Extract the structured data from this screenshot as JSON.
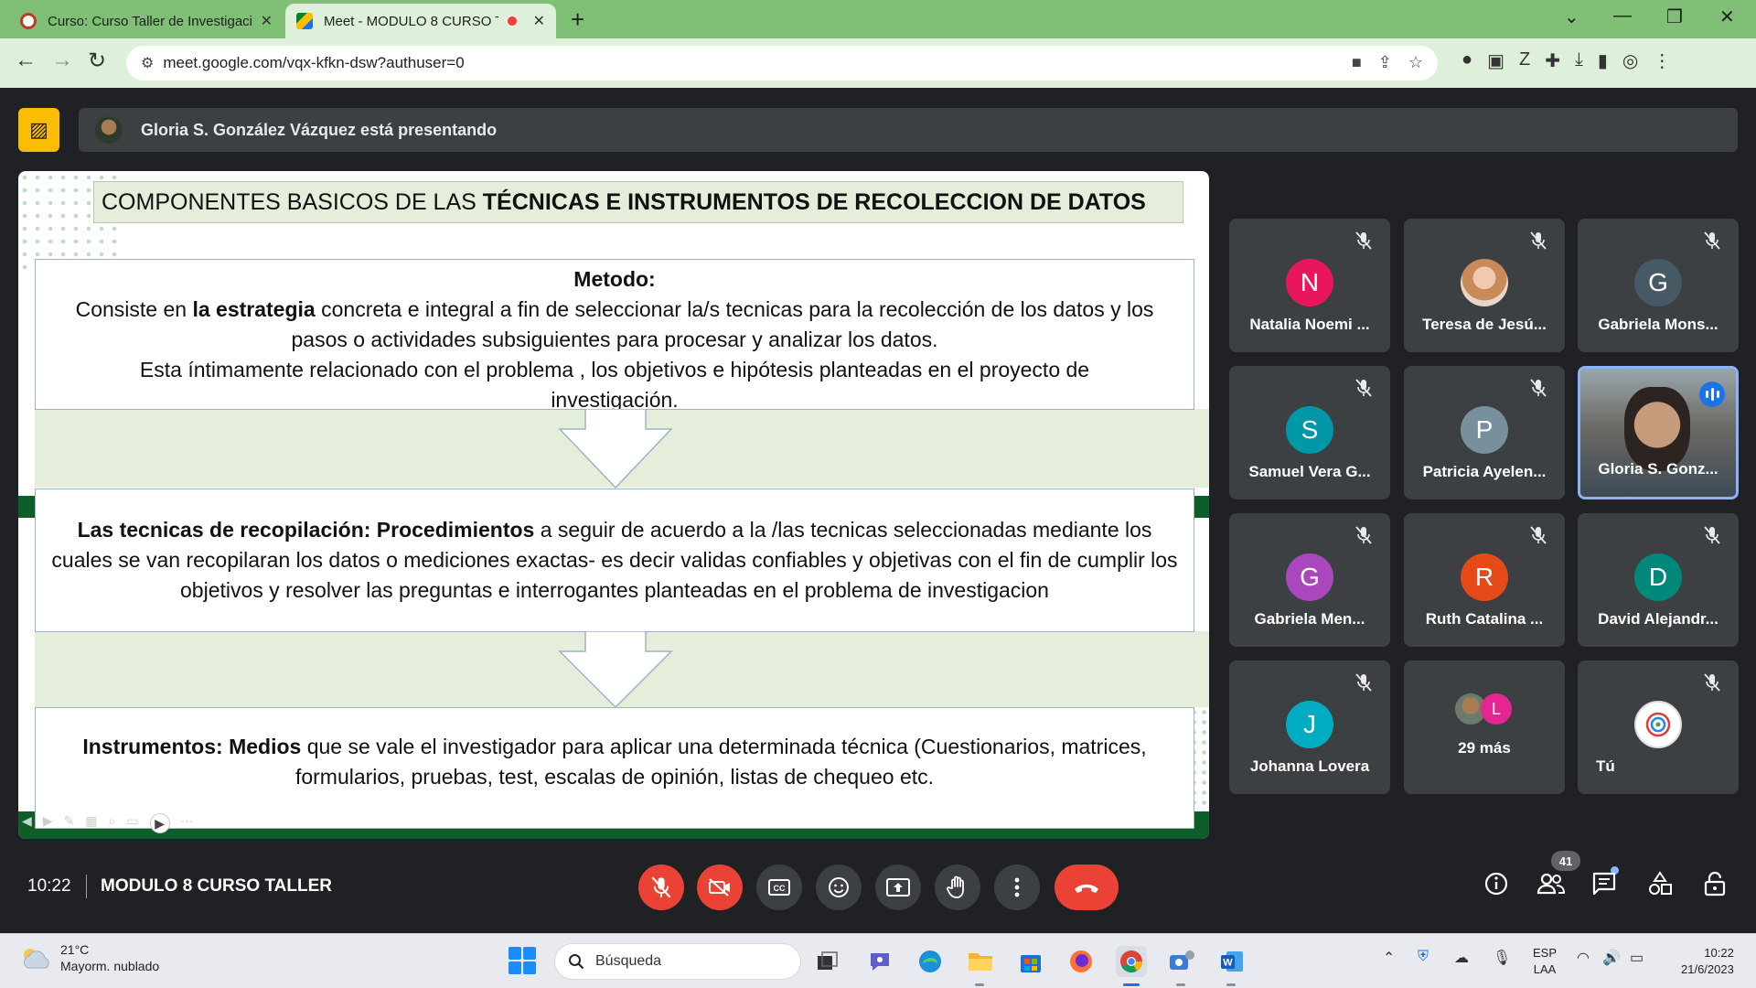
{
  "browser": {
    "tabs": [
      {
        "title": "Curso: Curso Taller de Investigaci",
        "close": "✕"
      },
      {
        "title": "Meet - MODULO 8 CURSO T",
        "close": "✕"
      }
    ],
    "new_tab": "+",
    "window_controls": [
      "⌄",
      "—",
      "❐",
      "✕"
    ],
    "url": "meet.google.com/vqx-kfkn-dsw?authuser=0"
  },
  "meet": {
    "presenting_text": "Gloria S. González Vázquez está presentando",
    "time": "10:22",
    "meeting_name": "MODULO 8 CURSO TALLER",
    "people_count": "41"
  },
  "slide": {
    "title_part1": "COMPONENTES BASICOS DE LAS ",
    "title_part2": "TÉCNICAS  E INSTRUMENTOS DE RECOLECCION DE DATOS",
    "metodo": {
      "heading": "Metodo:",
      "p1_a": "Consiste  en ",
      "p1_b": "la  estrategia",
      "p1_c": " concreta e integral   a fin de  seleccionar  la/s tecnicas para la recolección de los datos y los pasos o actividades subsiguientes para procesar y analizar los datos.",
      "p2": "Esta íntimamente relacionado con el problema , los objetivos e hipótesis planteadas en el proyecto de investigación."
    },
    "tecnicas": {
      "bold": "Las tecnicas de recopilación: Procedimientos",
      "rest": " a seguir de acuerdo a la /las tecnicas seleccionadas  mediante los cuales se  van recopilaran los  datos o mediciones exactas- es decir validas confiables y objetivas con el fin de cumplir los objetivos y  resolver las preguntas e interrogantes planteadas en el problema de investigacion"
    },
    "instrumentos": {
      "bold": "Instrumentos: Medios",
      "rest": "  que se vale el investigador para aplicar una determinada técnica (Cuestionarios, matrices, formularios, pruebas, test, escalas de opinión, listas de chequeo etc."
    }
  },
  "participants": [
    {
      "name": "Natalia Noemi ...",
      "initial": "N",
      "color": "#e8175d"
    },
    {
      "name": "Teresa de Jesú...",
      "initial": "",
      "color": "#e9b6a0"
    },
    {
      "name": "Gabriela Mons...",
      "initial": "G",
      "color": "#455a64"
    },
    {
      "name": "Samuel Vera G...",
      "initial": "S",
      "color": "#0097a7"
    },
    {
      "name": "Patricia Ayelen...",
      "initial": "P",
      "color": "#78909c"
    },
    {
      "name": "Gloria S. Gonz...",
      "initial": "",
      "color": "#1a73e8"
    },
    {
      "name": "Gabriela Men...",
      "initial": "G",
      "color": "#ab47bc"
    },
    {
      "name": "Ruth Catalina ...",
      "initial": "R",
      "color": "#e64a19"
    },
    {
      "name": "David Alejandr...",
      "initial": "D",
      "color": "#00897b"
    },
    {
      "name": "Johanna Lovera",
      "initial": "J",
      "color": "#00acc1"
    }
  ],
  "more_tile": {
    "initial": "L",
    "label": "29 más"
  },
  "self_tile": {
    "label": "Tú"
  },
  "taskbar": {
    "weather_temp": "21°C",
    "weather_desc": "Mayorm. nublado",
    "search_label": "Búsqueda",
    "lang_line1": "ESP",
    "lang_line2": "LAA",
    "clock_time": "10:22",
    "clock_date": "21/6/2023"
  }
}
